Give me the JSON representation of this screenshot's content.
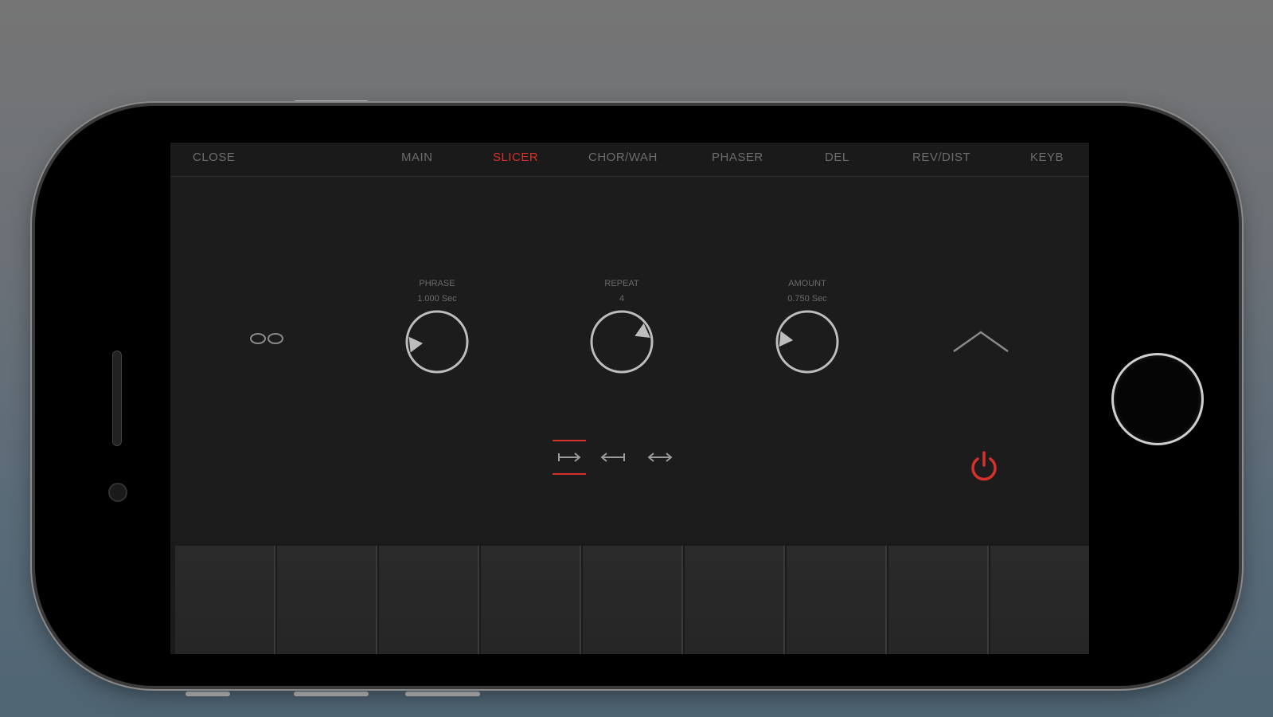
{
  "nav": {
    "close": "CLOSE",
    "tabs": [
      "MAIN",
      "SLICER",
      "CHOR/WAH",
      "PHASER",
      "DEL",
      "REV/DIST",
      "KEYB"
    ],
    "active_tab": "SLICER"
  },
  "knobs": [
    {
      "label": "PHRASE",
      "value": "1.000 Sec",
      "level": 0.08
    },
    {
      "label": "REPEAT",
      "value": "4",
      "level": 0.62
    },
    {
      "label": "AMOUNT",
      "value": "0.750 Sec",
      "level": 0.12
    }
  ],
  "direction_buttons": [
    {
      "icon": "arrow-right-icon",
      "selected": true
    },
    {
      "icon": "arrow-left-icon",
      "selected": false
    },
    {
      "icon": "arrow-both-icon",
      "selected": false
    }
  ],
  "icons": {
    "link": "link-icon",
    "collapse": "chevron-up-icon",
    "power": "power-icon"
  },
  "colors": {
    "accent": "#d7312b",
    "text": "#6c6c6c",
    "background": "#1c1c1d"
  },
  "keyboard": {
    "pad_count": 9
  }
}
